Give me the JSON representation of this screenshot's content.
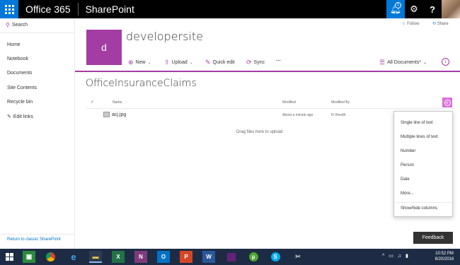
{
  "suite": {
    "brand": "Office 365",
    "app": "SharePoint",
    "notification_count": "1",
    "settings_glyph": "⚙",
    "help_glyph": "?"
  },
  "leftnav": {
    "search_label": "Search",
    "items": [
      "Home",
      "Notebook",
      "Documents",
      "Site Contents",
      "Recycle bin"
    ],
    "edit_links": "Edit links",
    "return_classic": "Return to classic SharePoint"
  },
  "site": {
    "logo_letter": "d",
    "title": "developersite",
    "follow": "Follow",
    "share": "Share"
  },
  "commands": {
    "new": "New",
    "upload": "Upload",
    "quick_edit": "Quick edit",
    "sync": "Sync",
    "more": "···",
    "view": "All Documents*"
  },
  "list": {
    "title": "OfficeInsuranceClaims",
    "columns": {
      "name": "Name",
      "modified": "Modified",
      "modified_by": "Modified By"
    },
    "rows": [
      {
        "name": "acj.jpg",
        "modified": "About a minute ago",
        "modified_by": "N Vinodh"
      }
    ],
    "drag_hint": "Drag files here to upload"
  },
  "add_column_menu": {
    "items": [
      "Single line of text",
      "Multiple lines of text",
      "Number",
      "Person",
      "Date",
      "More..."
    ],
    "footer": "Show/hide columns"
  },
  "feedback": "Feedback",
  "taskbar": {
    "time": "10:52 PM",
    "date": "8/20/2016"
  },
  "colors": {
    "accent": "#a33ca3",
    "suitebar": "#000000",
    "waffle": "#0078d7",
    "taskbar": "#1d2c44"
  }
}
